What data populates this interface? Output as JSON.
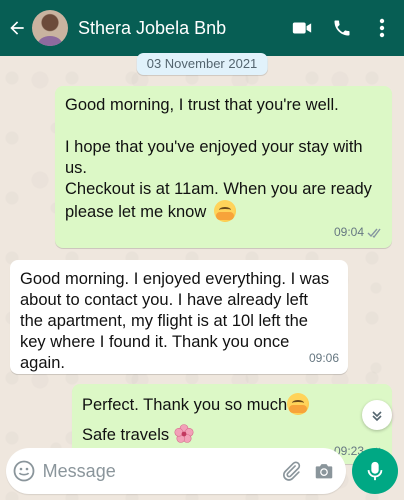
{
  "header": {
    "contact_name": "Sthera Jobela Bnb",
    "icons": [
      "back-arrow-icon",
      "video-call-icon",
      "voice-call-icon",
      "more-options-icon"
    ]
  },
  "date_chip": "03 November 2021",
  "messages": [
    {
      "direction": "outgoing",
      "paragraphs": [
        "Good morning, I trust that you're well.",
        "I hope that you've enjoyed your stay with us.",
        "Checkout is at 11am. When you are ready please let me know"
      ],
      "emoji": "hugging-face-emoji",
      "time": "09:04",
      "status": "read"
    },
    {
      "direction": "incoming",
      "text": "Good morning. I enjoyed everything. I was about to contact you. I have already left the apartment, my flight is at 10l left the key where I found it. Thank you once again.",
      "time": "09:06"
    },
    {
      "direction": "outgoing",
      "line1": "Perfect. Thank you so much",
      "line1_emoji": "hugging-face-emoji",
      "line2": "Safe travels",
      "line2_emoji": "cherry-blossom-emoji",
      "time": "09:23",
      "status": "read"
    }
  ],
  "composer": {
    "placeholder": "Message",
    "icons": [
      "emoji-icon",
      "attach-icon",
      "camera-icon",
      "microphone-icon"
    ]
  },
  "colors": {
    "header": "#075E54",
    "outgoing_bubble": "#DCF8C6",
    "incoming_bubble": "#FFFFFF",
    "mic_button": "#00A884",
    "read_tick": "#53BDEB"
  }
}
